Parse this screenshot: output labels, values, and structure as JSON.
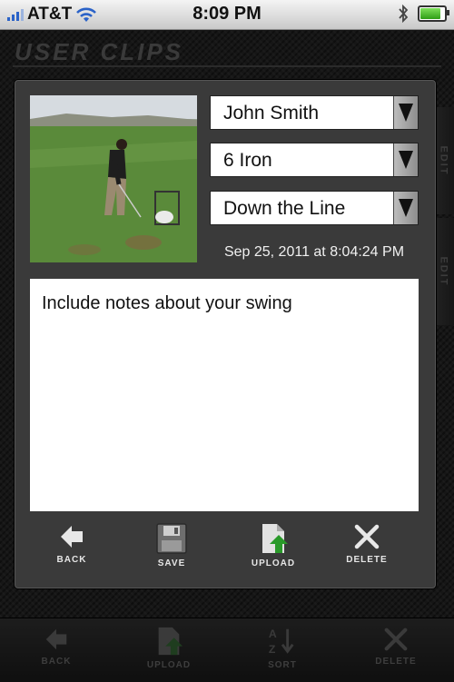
{
  "status_bar": {
    "carrier": "AT&T",
    "time": "8:09 PM",
    "battery_level": 0.9,
    "signal_bars": 3
  },
  "screen_title": "USER CLIPS",
  "side_tabs": [
    "EDIT",
    "EDIT"
  ],
  "clip": {
    "player": "John Smith",
    "club": "6 Iron",
    "view": "Down the Line",
    "timestamp": "Sep 25, 2011 at 8:04:24 PM",
    "notes_placeholder": "Include notes about your swing",
    "thumbnail_icon": "golf-swing-video-thumbnail"
  },
  "actions": [
    {
      "label": "BACK",
      "icon": "back-arrow-icon"
    },
    {
      "label": "SAVE",
      "icon": "floppy-disk-icon"
    },
    {
      "label": "UPLOAD",
      "icon": "upload-icon"
    },
    {
      "label": "DELETE",
      "icon": "delete-x-icon"
    }
  ],
  "toolbar": [
    {
      "label": "BACK",
      "icon": "back-arrow-icon"
    },
    {
      "label": "UPLOAD",
      "icon": "upload-icon"
    },
    {
      "label": "SORT",
      "icon": "sort-az-icon"
    },
    {
      "label": "DELETE",
      "icon": "delete-x-icon"
    }
  ],
  "colors": {
    "background": "#161616",
    "panel": "#3a3a3a",
    "upload_arrow": "#2a9a2a",
    "signal": "#2a62c8"
  }
}
